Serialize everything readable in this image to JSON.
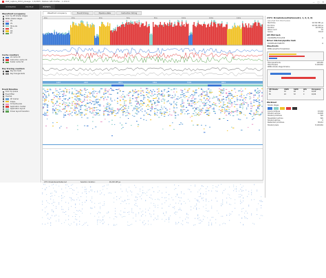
{
  "window": {
    "title": "RGP_capture_DX12_plusage - 1/1/2023 - Radeon GPU Profiler - 1.13.0.0",
    "controls": [
      "—",
      "□",
      "✕"
    ]
  },
  "main_tabs": [
    {
      "label": "OVERVIEW",
      "active": false
    },
    {
      "label": "PROFILE",
      "active": false
    },
    {
      "label": "EVENTS",
      "active": true
    }
  ],
  "sub_tabs": [
    {
      "label": "Wavefront occupancy",
      "active": true
    },
    {
      "label": "Event timing",
      "active": false
    },
    {
      "label": "Pipeline state",
      "active": false
    },
    {
      "label": "Instruction timing",
      "active": false
    }
  ],
  "left_panel": {
    "wavefront": {
      "title": "Wavefront occupancy",
      "options": [
        "Color by API shader stages",
        "RDNA shader stages"
      ],
      "legend": [
        {
          "label": "CS",
          "color": "#e8a9c8"
        },
        {
          "label": "VS",
          "color": "#3a78d6"
        },
        {
          "label": "HS & GS",
          "color": "#8ad0c8"
        },
        {
          "label": "PS",
          "color": "#e03b3b"
        },
        {
          "label": "GS",
          "color": "#f0c32a"
        },
        {
          "label": "RT",
          "color": "#59a14f"
        }
      ]
    },
    "cache": {
      "title": "Cache counters",
      "items": [
        {
          "label": "L0 cache hit",
          "color": "#3a78d6"
        },
        {
          "label": "Instruction cache hit",
          "color": "#e03b3b"
        },
        {
          "label": "Scalar cache hit",
          "color": "#59a14f"
        }
      ]
    },
    "raytracing": {
      "title": "Ray tracing counters",
      "items": [
        {
          "label": "Ray box tests",
          "color": "#333333"
        },
        {
          "label": "Ray triangle tests",
          "color": "#999999"
        }
      ]
    },
    "events": {
      "title": "Event timeline",
      "options": [
        "Color by queue",
        "Event filter",
        "Overlap"
      ],
      "legend": [
        {
          "label": "CP marker",
          "color": "#6aa6d9"
        },
        {
          "label": "Draws",
          "color": "#f0c32a"
        },
        {
          "label": "Compute pass",
          "color": "#e88ec2"
        },
        {
          "label": "Application marker",
          "color": "#e03b3b"
        },
        {
          "label": "Application layout",
          "color": "#8ad0c8"
        },
        {
          "label": "Driver layout transition",
          "color": "#59a14f"
        }
      ]
    }
  },
  "timeline": {
    "ruler_ticks": [
      "0ms",
      "2ms",
      "4ms",
      "6ms",
      "8ms",
      "10ms",
      "12ms",
      "14ms",
      "16ms"
    ],
    "event_labels": [
      "1207",
      "2407",
      "4871",
      "5361",
      "5702",
      "6821"
    ]
  },
  "status_bar": {
    "event": "2371 DrawIndexedInstanced",
    "selection": "Selection duration:",
    "duration": "16,218.195 μs"
  },
  "right_panel": {
    "title": "2371: DrawIndexedInstanced(1, 1, 0, 0, 0)",
    "subtitle": "Launched from Direct queue",
    "timing": [
      {
        "k": "Start time",
        "v": "10,322.381 μs"
      },
      {
        "k": "End time",
        "v": "10,341.920 μs"
      },
      {
        "k": "Duration",
        "v": "19.539 μs"
      },
      {
        "k": "Wave count",
        "v": "16"
      },
      {
        "k": "Queue",
        "v": "Direct"
      }
    ],
    "api_hash_label": "API PSO hash",
    "api_hash": "0x4d0b8f2e79c1a3d6",
    "driver_hash_label": "Driver internal pipeline hash",
    "driver_hash": "0x0dbf1e42c3a9b7f0",
    "wavefronts_label": "Wavefronts",
    "rdna_breakdown": "RDNA wavefront breakdown",
    "total_wavefronts_label": "Total wavefronts",
    "total_wavefronts": "128,481",
    "total_threads_label": "Total threads",
    "total_threads": "8,194,961",
    "stage_timeline_label": "RDNA shader stage timeline",
    "api_shader_table": {
      "headers": [
        "API Shader",
        "VGPR",
        "SGPR",
        "LDS",
        "Occupancy"
      ],
      "rows": [
        [
          "VS",
          "32",
          "48",
          "0",
          "16/16"
        ],
        [
          "PS",
          "24",
          "32",
          "0",
          "16/16"
        ]
      ]
    },
    "workload_label": "Workload",
    "shader_stages_label": "Shader stages",
    "workload": [
      {
        "k": "Input primitives",
        "v": "43,218"
      },
      {
        "k": "Shaded vertices",
        "v": "91,820"
      },
      {
        "k": "Shaded primitives",
        "v": "N/A"
      },
      {
        "k": "Tessellated vertices",
        "v": "N/A"
      },
      {
        "k": "Shaded patches",
        "v": "0"
      },
      {
        "k": "Rasterized primitives",
        "v": "38,412"
      },
      {
        "k": "Shaded pixels",
        "v": "8,194,961"
      }
    ]
  }
}
